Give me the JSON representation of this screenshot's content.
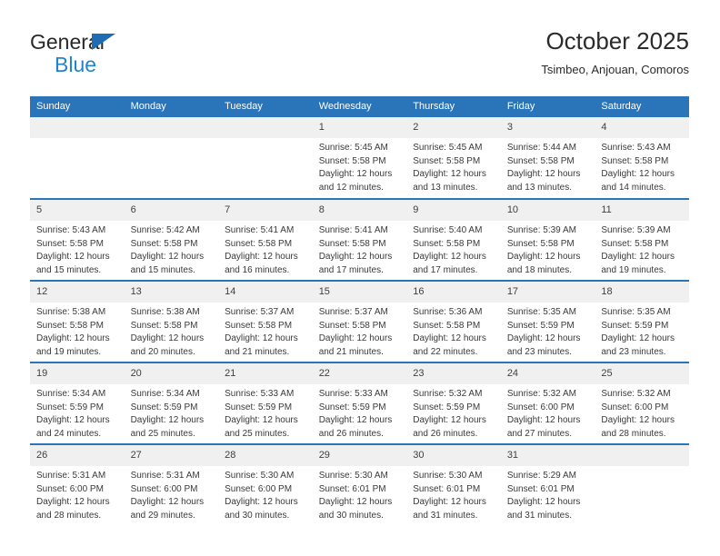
{
  "brand": {
    "name_part1": "General",
    "name_part2": "Blue",
    "accent_color": "#2283d0",
    "triangle_color": "#1f6cb4"
  },
  "header": {
    "title": "October 2025",
    "subtitle": "Tsimbeo, Anjouan, Comoros"
  },
  "theme": {
    "header_blue": "#2a74b9",
    "daynum_gray": "#f0f0f0"
  },
  "weekday_headers": [
    "Sunday",
    "Monday",
    "Tuesday",
    "Wednesday",
    "Thursday",
    "Friday",
    "Saturday"
  ],
  "labels": {
    "sunrise_prefix": "Sunrise: ",
    "sunset_prefix": "Sunset: ",
    "daylight_prefix": "Daylight: "
  },
  "weeks": [
    [
      {
        "day": "",
        "sunrise": "",
        "sunset": "",
        "daylight": "",
        "empty": true
      },
      {
        "day": "",
        "sunrise": "",
        "sunset": "",
        "daylight": "",
        "empty": true
      },
      {
        "day": "",
        "sunrise": "",
        "sunset": "",
        "daylight": "",
        "empty": true
      },
      {
        "day": "1",
        "sunrise": "Sunrise: 5:45 AM",
        "sunset": "Sunset: 5:58 PM",
        "daylight": "Daylight: 12 hours and 12 minutes."
      },
      {
        "day": "2",
        "sunrise": "Sunrise: 5:45 AM",
        "sunset": "Sunset: 5:58 PM",
        "daylight": "Daylight: 12 hours and 13 minutes."
      },
      {
        "day": "3",
        "sunrise": "Sunrise: 5:44 AM",
        "sunset": "Sunset: 5:58 PM",
        "daylight": "Daylight: 12 hours and 13 minutes."
      },
      {
        "day": "4",
        "sunrise": "Sunrise: 5:43 AM",
        "sunset": "Sunset: 5:58 PM",
        "daylight": "Daylight: 12 hours and 14 minutes."
      }
    ],
    [
      {
        "day": "5",
        "sunrise": "Sunrise: 5:43 AM",
        "sunset": "Sunset: 5:58 PM",
        "daylight": "Daylight: 12 hours and 15 minutes."
      },
      {
        "day": "6",
        "sunrise": "Sunrise: 5:42 AM",
        "sunset": "Sunset: 5:58 PM",
        "daylight": "Daylight: 12 hours and 15 minutes."
      },
      {
        "day": "7",
        "sunrise": "Sunrise: 5:41 AM",
        "sunset": "Sunset: 5:58 PM",
        "daylight": "Daylight: 12 hours and 16 minutes."
      },
      {
        "day": "8",
        "sunrise": "Sunrise: 5:41 AM",
        "sunset": "Sunset: 5:58 PM",
        "daylight": "Daylight: 12 hours and 17 minutes."
      },
      {
        "day": "9",
        "sunrise": "Sunrise: 5:40 AM",
        "sunset": "Sunset: 5:58 PM",
        "daylight": "Daylight: 12 hours and 17 minutes."
      },
      {
        "day": "10",
        "sunrise": "Sunrise: 5:39 AM",
        "sunset": "Sunset: 5:58 PM",
        "daylight": "Daylight: 12 hours and 18 minutes."
      },
      {
        "day": "11",
        "sunrise": "Sunrise: 5:39 AM",
        "sunset": "Sunset: 5:58 PM",
        "daylight": "Daylight: 12 hours and 19 minutes."
      }
    ],
    [
      {
        "day": "12",
        "sunrise": "Sunrise: 5:38 AM",
        "sunset": "Sunset: 5:58 PM",
        "daylight": "Daylight: 12 hours and 19 minutes."
      },
      {
        "day": "13",
        "sunrise": "Sunrise: 5:38 AM",
        "sunset": "Sunset: 5:58 PM",
        "daylight": "Daylight: 12 hours and 20 minutes."
      },
      {
        "day": "14",
        "sunrise": "Sunrise: 5:37 AM",
        "sunset": "Sunset: 5:58 PM",
        "daylight": "Daylight: 12 hours and 21 minutes."
      },
      {
        "day": "15",
        "sunrise": "Sunrise: 5:37 AM",
        "sunset": "Sunset: 5:58 PM",
        "daylight": "Daylight: 12 hours and 21 minutes."
      },
      {
        "day": "16",
        "sunrise": "Sunrise: 5:36 AM",
        "sunset": "Sunset: 5:58 PM",
        "daylight": "Daylight: 12 hours and 22 minutes."
      },
      {
        "day": "17",
        "sunrise": "Sunrise: 5:35 AM",
        "sunset": "Sunset: 5:59 PM",
        "daylight": "Daylight: 12 hours and 23 minutes."
      },
      {
        "day": "18",
        "sunrise": "Sunrise: 5:35 AM",
        "sunset": "Sunset: 5:59 PM",
        "daylight": "Daylight: 12 hours and 23 minutes."
      }
    ],
    [
      {
        "day": "19",
        "sunrise": "Sunrise: 5:34 AM",
        "sunset": "Sunset: 5:59 PM",
        "daylight": "Daylight: 12 hours and 24 minutes."
      },
      {
        "day": "20",
        "sunrise": "Sunrise: 5:34 AM",
        "sunset": "Sunset: 5:59 PM",
        "daylight": "Daylight: 12 hours and 25 minutes."
      },
      {
        "day": "21",
        "sunrise": "Sunrise: 5:33 AM",
        "sunset": "Sunset: 5:59 PM",
        "daylight": "Daylight: 12 hours and 25 minutes."
      },
      {
        "day": "22",
        "sunrise": "Sunrise: 5:33 AM",
        "sunset": "Sunset: 5:59 PM",
        "daylight": "Daylight: 12 hours and 26 minutes."
      },
      {
        "day": "23",
        "sunrise": "Sunrise: 5:32 AM",
        "sunset": "Sunset: 5:59 PM",
        "daylight": "Daylight: 12 hours and 26 minutes."
      },
      {
        "day": "24",
        "sunrise": "Sunrise: 5:32 AM",
        "sunset": "Sunset: 6:00 PM",
        "daylight": "Daylight: 12 hours and 27 minutes."
      },
      {
        "day": "25",
        "sunrise": "Sunrise: 5:32 AM",
        "sunset": "Sunset: 6:00 PM",
        "daylight": "Daylight: 12 hours and 28 minutes."
      }
    ],
    [
      {
        "day": "26",
        "sunrise": "Sunrise: 5:31 AM",
        "sunset": "Sunset: 6:00 PM",
        "daylight": "Daylight: 12 hours and 28 minutes."
      },
      {
        "day": "27",
        "sunrise": "Sunrise: 5:31 AM",
        "sunset": "Sunset: 6:00 PM",
        "daylight": "Daylight: 12 hours and 29 minutes."
      },
      {
        "day": "28",
        "sunrise": "Sunrise: 5:30 AM",
        "sunset": "Sunset: 6:00 PM",
        "daylight": "Daylight: 12 hours and 30 minutes."
      },
      {
        "day": "29",
        "sunrise": "Sunrise: 5:30 AM",
        "sunset": "Sunset: 6:01 PM",
        "daylight": "Daylight: 12 hours and 30 minutes."
      },
      {
        "day": "30",
        "sunrise": "Sunrise: 5:30 AM",
        "sunset": "Sunset: 6:01 PM",
        "daylight": "Daylight: 12 hours and 31 minutes."
      },
      {
        "day": "31",
        "sunrise": "Sunrise: 5:29 AM",
        "sunset": "Sunset: 6:01 PM",
        "daylight": "Daylight: 12 hours and 31 minutes."
      },
      {
        "day": "",
        "sunrise": "",
        "sunset": "",
        "daylight": "",
        "empty": true
      }
    ]
  ]
}
